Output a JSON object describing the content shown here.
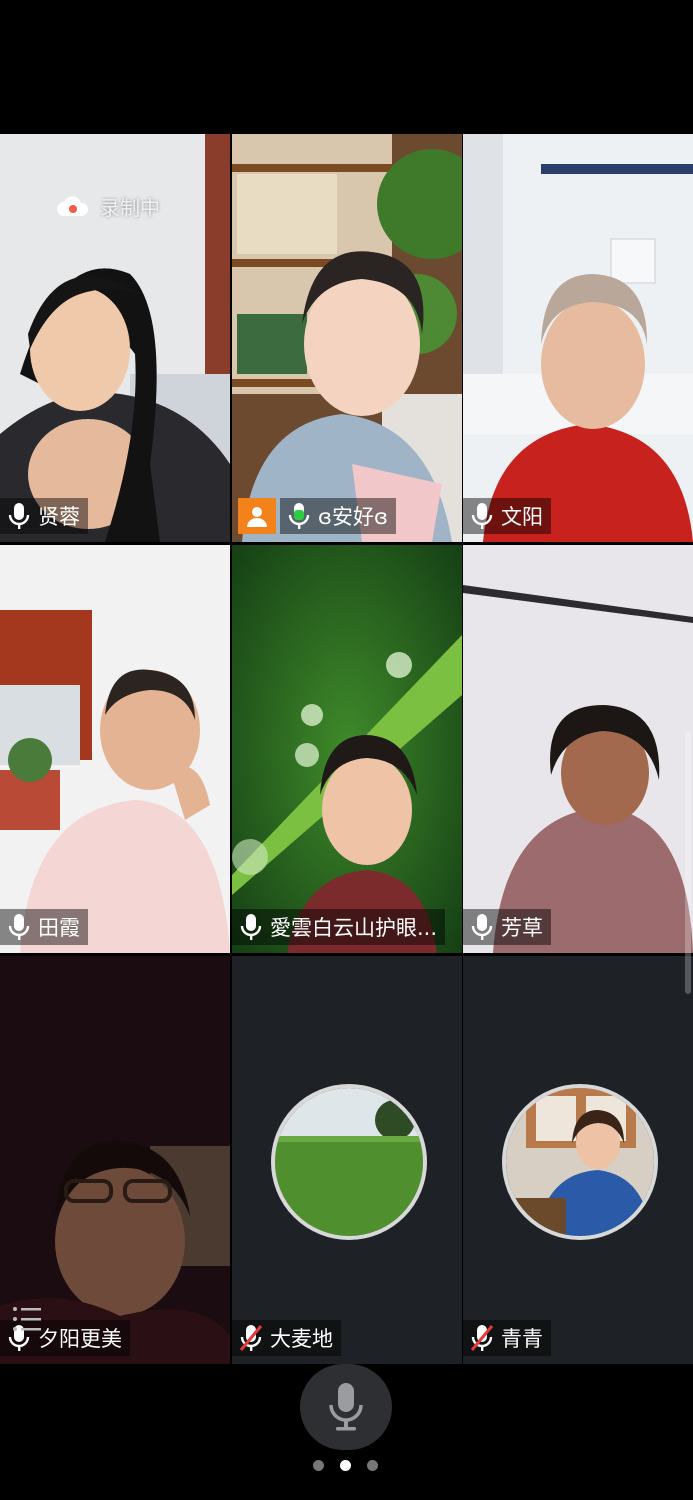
{
  "recording": {
    "label": "录制中"
  },
  "participants": [
    {
      "name": "贤蓉",
      "mic": "on"
    },
    {
      "name": "ɞ安好ɞ",
      "mic": "active",
      "host": true
    },
    {
      "name": "文阳",
      "mic": "on"
    },
    {
      "name": "田霞",
      "mic": "on"
    },
    {
      "name": "愛雲白云山护眼...",
      "mic": "on"
    },
    {
      "name": "芳草",
      "mic": "on"
    },
    {
      "name": "夕阳更美",
      "mic": "on"
    },
    {
      "name": "大麦地",
      "mic": "muted"
    },
    {
      "name": "青青",
      "mic": "muted"
    }
  ],
  "pager": {
    "pages": 3,
    "current": 2
  },
  "colors": {
    "host_badge": "#f3821b",
    "active_mic": "#2ecc40",
    "muted_mic": "#e53935"
  }
}
